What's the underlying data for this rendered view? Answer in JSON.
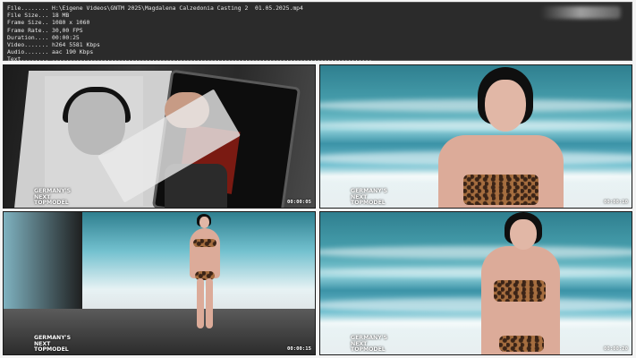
{
  "info": {
    "rows": [
      {
        "key": "File........",
        "value": "H:\\Eigene Videos\\GNTM 2025\\Magdalena Calzedonia Casting 2  01.05.2025.mp4"
      },
      {
        "key": "File Size...",
        "value": "18 MB"
      },
      {
        "key": "Frame Size..",
        "value": "1080 x 1060"
      },
      {
        "key": "Frame Rate..",
        "value": "30,00 FPS"
      },
      {
        "key": "Duration....",
        "value": "00:00:25"
      },
      {
        "key": "Video.......",
        "value": "h264 5581 Kbps"
      },
      {
        "key": "Audio.......",
        "value": "aac 190 Kbps"
      },
      {
        "key": "Text........",
        "value": "............................................................................................."
      }
    ]
  },
  "thumbnails": [
    {
      "timecode": "00:00:05",
      "logo": [
        "GERMANY'S",
        "NEXT",
        "TOPMODEL"
      ]
    },
    {
      "timecode": "00:00:10",
      "logo": [
        "GERMANY'S",
        "NEXT",
        "TOPMODEL"
      ]
    },
    {
      "timecode": "00:00:15",
      "logo": [
        "GERMANY'S",
        "NEXT",
        "TOPMODEL"
      ]
    },
    {
      "timecode": "00:00:20",
      "logo": [
        "GERMANY'S",
        "NEXT",
        "TOPMODEL"
      ]
    }
  ]
}
